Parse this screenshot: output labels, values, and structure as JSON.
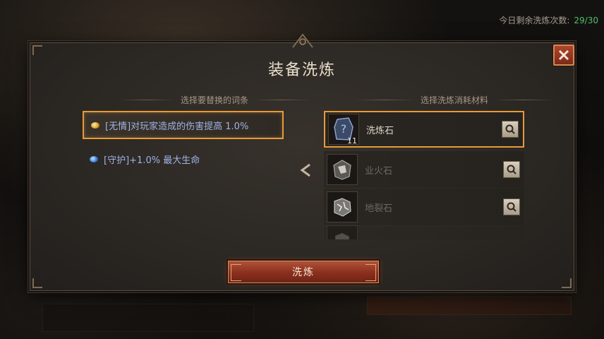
{
  "header": {
    "refine_label": "今日剩余洗炼次数:",
    "refine_count": "29/30"
  },
  "dialog": {
    "title": "装备洗炼",
    "left_section_title": "选择要替换的词条",
    "right_section_title": "选择洗炼消耗材料",
    "affixes": [
      {
        "text": "[无情]对玩家造成的伤害提高 1.0%",
        "gem": "gold-gem-icon",
        "selected": true
      },
      {
        "text": "[守护]+1.0% 最大生命",
        "gem": "blue-gem-icon",
        "selected": false
      }
    ],
    "materials": [
      {
        "name": "洗炼石",
        "count": "11",
        "icon": "refine-stone-icon",
        "selected": true
      },
      {
        "name": "业火石",
        "count": "",
        "icon": "hellfire-stone-icon",
        "selected": false
      },
      {
        "name": "地裂石",
        "count": "",
        "icon": "earthsplit-stone-icon",
        "selected": false
      }
    ],
    "refine_button": "洗炼"
  },
  "colors": {
    "selected_border": "#e79a3a",
    "affix_text": "#9fb2e6",
    "counter_value": "#4fc06a",
    "button_red": "#8a2f1e"
  }
}
